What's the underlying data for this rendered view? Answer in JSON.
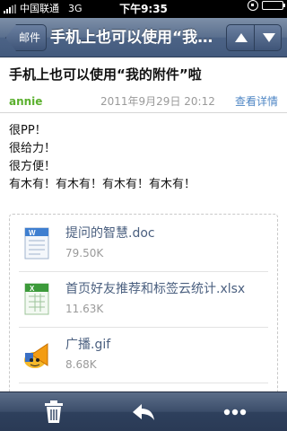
{
  "status_bar": {
    "carrier": "中国联通",
    "network": "3G",
    "time": "下午9:35"
  },
  "nav": {
    "back_label": "邮件",
    "title": "手机上也可以使用“我的附件”啦",
    "up_icon": "up-arrow-icon",
    "down_icon": "down-arrow-icon"
  },
  "mail": {
    "subject": "手机上也可以使用“我的附件”啦",
    "sender": "annie",
    "date": "2011年9月29日  20:12",
    "details_link": "查看详情",
    "body_lines": [
      "很PP！",
      "很给力！",
      "很方便！",
      "有木有！有木有！有木有！有木有！"
    ]
  },
  "attachments": [
    {
      "name": "提问的智慧.doc",
      "size": "79.50K",
      "icon": "word-doc-icon"
    },
    {
      "name": "首页好友推荐和标签云统计.xlsx",
      "size": "11.63K",
      "icon": "excel-icon"
    },
    {
      "name": "广播.gif",
      "size": "8.68K",
      "icon": "gif-broadcast-icon"
    },
    {
      "name": "",
      "size": "",
      "icon": "file-icon"
    }
  ],
  "toolbar": {
    "trash_icon": "trash-icon",
    "reply_icon": "reply-icon",
    "more_icon": "more-icon"
  },
  "colors": {
    "nav_bar": "#5a6f8e",
    "sender": "#5bb02e",
    "link": "#4e86c4",
    "attachment_name": "#4a5f7f"
  }
}
